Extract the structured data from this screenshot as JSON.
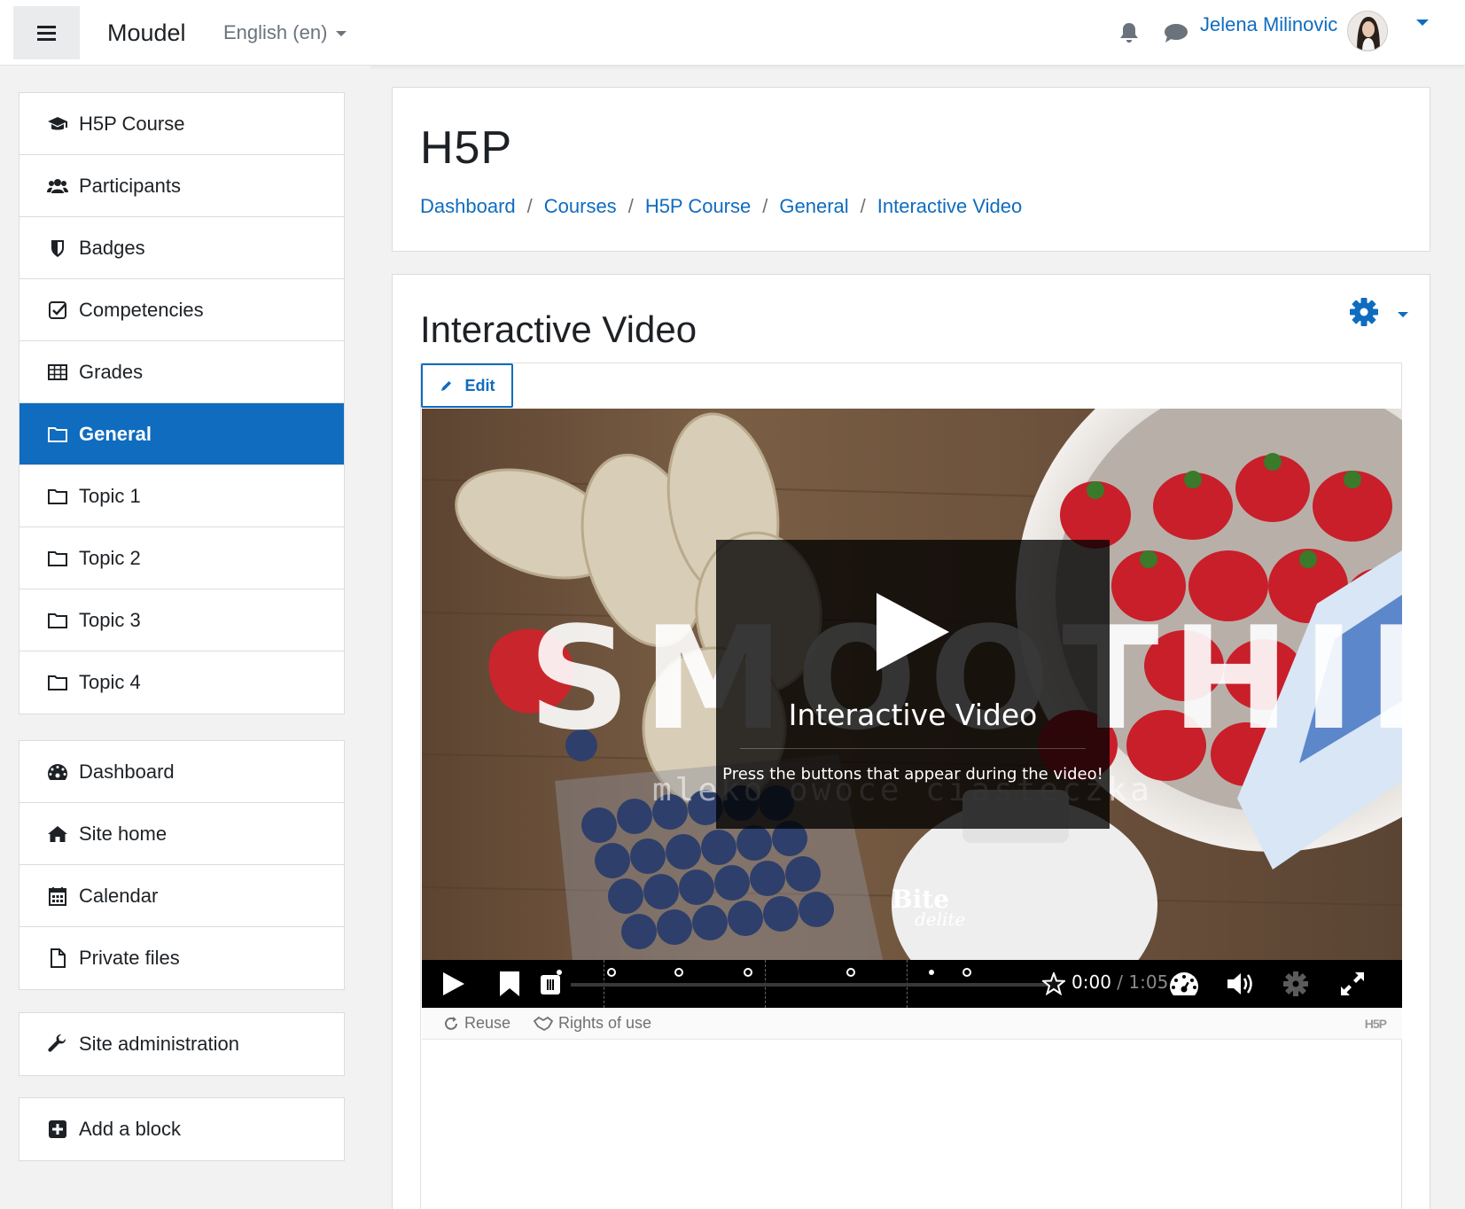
{
  "navbar": {
    "brand": "Moudel",
    "language": "English ‎(en)‎",
    "user_name": "Jelena Milinovic"
  },
  "drawer": {
    "course_nav": [
      {
        "label": "H5P Course",
        "icon": "graduation-cap-icon"
      },
      {
        "label": "Participants",
        "icon": "users-icon"
      },
      {
        "label": "Badges",
        "icon": "shield-icon"
      },
      {
        "label": "Competencies",
        "icon": "check-square-icon"
      },
      {
        "label": "Grades",
        "icon": "table-icon"
      },
      {
        "label": "General",
        "icon": "folder-icon",
        "active": true
      },
      {
        "label": "Topic 1",
        "icon": "folder-icon"
      },
      {
        "label": "Topic 2",
        "icon": "folder-icon"
      },
      {
        "label": "Topic 3",
        "icon": "folder-icon"
      },
      {
        "label": "Topic 4",
        "icon": "folder-icon"
      }
    ],
    "site_nav": [
      {
        "label": "Dashboard",
        "icon": "tachometer-icon"
      },
      {
        "label": "Site home",
        "icon": "home-icon"
      },
      {
        "label": "Calendar",
        "icon": "calendar-icon"
      },
      {
        "label": "Private files",
        "icon": "file-icon"
      }
    ],
    "admin_nav": [
      {
        "label": "Site administration",
        "icon": "wrench-icon"
      }
    ],
    "block_nav": [
      {
        "label": "Add a block",
        "icon": "plus-square-icon"
      }
    ]
  },
  "header": {
    "title": "H5P",
    "breadcrumb": [
      "Dashboard",
      "Courses",
      "H5P Course",
      "General",
      "Interactive Video"
    ]
  },
  "content": {
    "title": "Interactive Video",
    "edit_label": "Edit"
  },
  "video": {
    "overlay_title": "Interactive Video",
    "overlay_description": "Press the buttons that appear during the video!",
    "background_title": "SMOOTHIE",
    "background_subtitle": "mleko owoce ciasteczka",
    "logo_main": "Bite",
    "logo_sub": "delite",
    "current_time": "0:00",
    "time_separator": "/",
    "duration": "1:05",
    "progress": 0
  },
  "h5p_actions": {
    "reuse": "Reuse",
    "rights": "Rights of use",
    "badge": "H5P"
  },
  "colors": {
    "primary": "#0f6cbf",
    "page_bg": "#f2f2f2",
    "control_bar": "#000000"
  }
}
